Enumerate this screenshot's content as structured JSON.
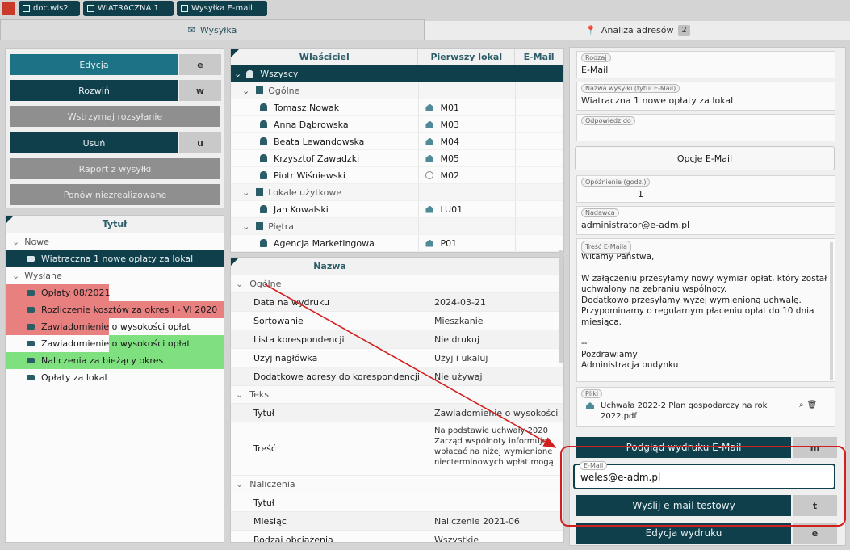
{
  "top_tabs": [
    "doc.wls2",
    "WIATRACZNA 1",
    "Wysyłka E-mail"
  ],
  "main_tabs": {
    "wyszukaj": "Wysyłka",
    "analiza": "Analiza adresów",
    "analiza_badge": "2"
  },
  "actions": {
    "edycja": "Edycja",
    "edycja_key": "e",
    "rozwin": "Rozwiń",
    "rozwin_key": "w",
    "wstrzymaj": "Wstrzymaj rozsyłanie",
    "usun": "Usuń",
    "usun_key": "u",
    "raport": "Raport z wysyłki",
    "ponow": "Ponów niezrealizowane"
  },
  "titles": {
    "header": "Tytuł",
    "groups": [
      {
        "label": "Nowe",
        "items": [
          {
            "label": "Wiatraczna 1 nowe opłaty za lokal",
            "status": "selected"
          }
        ]
      },
      {
        "label": "Wysłane",
        "items": [
          {
            "label": "Opłaty 08/2021",
            "status": "error"
          },
          {
            "label": "Rozliczenie kosztów za okres I - VI 2020",
            "status": "error"
          },
          {
            "label": "Zawiadomienie o wysokości opłat",
            "status": "error"
          },
          {
            "label": "Zawiadomienie o wysokości opłat",
            "status": "ok"
          },
          {
            "label": "Naliczenia za bieżący okres",
            "status": "ok"
          },
          {
            "label": "Opłaty za lokal",
            "status": "none"
          }
        ]
      }
    ]
  },
  "recipients": {
    "columns": [
      "Właściciel",
      "Pierwszy lokal",
      "E-Mail"
    ],
    "root": "Wszyscy",
    "groups": [
      {
        "label": "Ogólne",
        "rows": [
          {
            "name": "Tomasz Nowak",
            "lokal": "M01"
          },
          {
            "name": "Anna Dąbrowska",
            "lokal": "M03"
          },
          {
            "name": "Beata Lewandowska",
            "lokal": "M04"
          },
          {
            "name": "Krzysztof Zawadzki",
            "lokal": "M05"
          },
          {
            "name": "Piotr Wiśniewski",
            "lokal": "M02"
          }
        ]
      },
      {
        "label": "Lokale użytkowe",
        "rows": [
          {
            "name": "Jan Kowalski",
            "lokal": "LU01"
          }
        ]
      },
      {
        "label": "Piętra",
        "rows": [
          {
            "name": "Agencja Marketingowa",
            "lokal": "P01"
          }
        ]
      }
    ]
  },
  "properties": {
    "header": "Nazwa",
    "groups": [
      {
        "label": "Ogólne",
        "rows": [
          {
            "k": "Data na wydruku",
            "v": "2024-03-21"
          },
          {
            "k": "Sortowanie",
            "v": "Mieszkanie"
          },
          {
            "k": "Lista korespondencji",
            "v": "Nie drukuj"
          },
          {
            "k": "Użyj nagłówka",
            "v": "Użyj i ukaluj"
          },
          {
            "k": "Dodatkowe adresy do korespondencji",
            "v": "Nie używaj"
          }
        ]
      },
      {
        "label": "Tekst",
        "rows": [
          {
            "k": "Tytuł",
            "v": "Zawiadomienie o wysokości"
          },
          {
            "k": "Treść",
            "v": "Na podstawie uchwały 2020\nZarząd wspólnoty informuje\nwpłacać na niżej wymienione\nniecterminowych wpłat mogą"
          }
        ]
      },
      {
        "label": "Naliczenia",
        "rows": [
          {
            "k": "Tytuł",
            "v": ""
          },
          {
            "k": "Miesiąc",
            "v": "Naliczenie 2021-06"
          },
          {
            "k": "Rodzaj obciążenia",
            "v": "Wszystkie"
          },
          {
            "k": "",
            "v": ""
          }
        ]
      }
    ]
  },
  "email": {
    "rodzaj_label": "Rodzaj",
    "rodzaj": "E-Mail",
    "tytul_label": "Nazwa wysyłki (tytuł E-Mail)",
    "tytul": "Wiatraczna 1 nowe opłaty za lokal",
    "odpowiedz_label": "Odpowiedz do",
    "odpowiedz": "",
    "opcje_button": "Opcje E-Mail",
    "opoznienie_label": "Opóźnienie (godz.)",
    "opoznienie": "1",
    "nadawca_label": "Nadawca",
    "nadawca": "administrator@e-adm.pl",
    "tresc_label": "Treść E-Maila",
    "tresc_lines": [
      "Witamy Państwa,",
      "",
      "W załączeniu przesyłamy nowy wymiar opłat, który został",
      "uchwalony na zebraniu wspólnoty.",
      "Dodatkowo przesyłamy wyżej wymienioną uchwałę.",
      "Przypominamy o regularnym płaceniu opłat do 10 dnia",
      "miesiąca.",
      "",
      "--",
      "Pozdrawiamy",
      "Administracja budynku"
    ],
    "pliki_label": "Pliki",
    "plik": "Uchwała 2022-2 Plan gospodarczy na rok 2022.pdf",
    "podglad_button": "Podgląd wydruku E-Mail",
    "podglad_key": "m",
    "test_label": "E-Mail",
    "test_value": "weles@e-adm.pl",
    "wyslij_button": "Wyślij e-mail testowy",
    "wyslij_key": "t",
    "edycja_wydruku_button": "Edycja wydruku",
    "edycja_wydruku_key": "e"
  },
  "colors": {
    "primary": "#0e3f4b",
    "error_row": "#e98080",
    "ok_row": "#7fe07f",
    "annotation": "#d21f1f"
  }
}
